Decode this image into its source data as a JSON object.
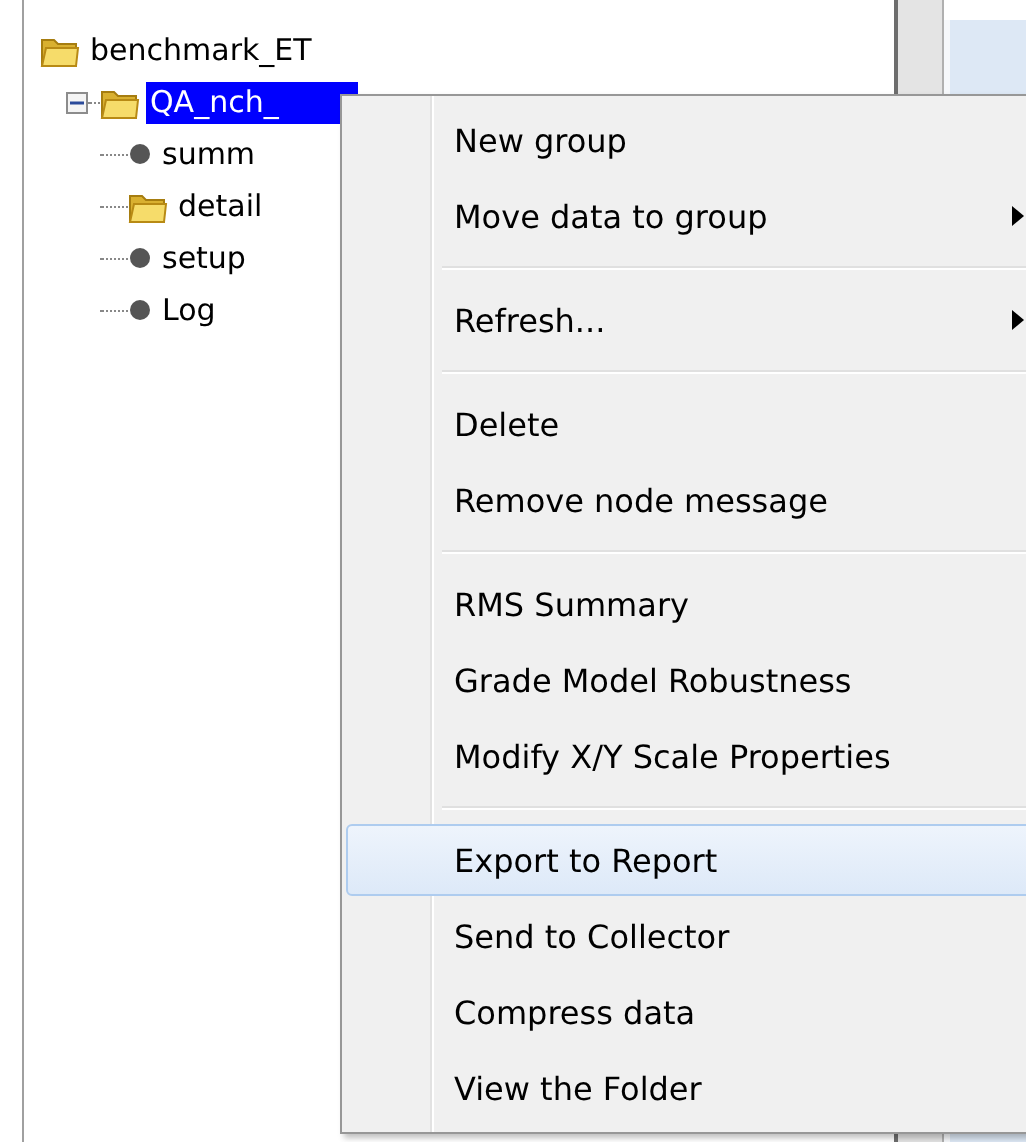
{
  "tree": [
    {
      "label": "benchmark_ET",
      "kind": "folder",
      "selected": false,
      "children": [
        {
          "label": "QA_nch_",
          "kind": "folder",
          "selected": true,
          "expanded": true,
          "children": [
            {
              "label": "summ",
              "kind": "leaf",
              "selected": false
            },
            {
              "label": "detail",
              "kind": "folder",
              "selected": false
            },
            {
              "label": "setup",
              "kind": "leaf",
              "selected": false
            },
            {
              "label": "Log",
              "kind": "leaf",
              "selected": false
            }
          ]
        }
      ]
    }
  ],
  "context_menu": [
    {
      "kind": "item",
      "label": "New group",
      "submenu": false,
      "selected": false
    },
    {
      "kind": "item",
      "label": "Move data to group",
      "submenu": true,
      "selected": false
    },
    {
      "kind": "separator"
    },
    {
      "kind": "item",
      "label": "Refresh...",
      "submenu": true,
      "selected": false
    },
    {
      "kind": "separator"
    },
    {
      "kind": "item",
      "label": "Delete",
      "submenu": false,
      "selected": false
    },
    {
      "kind": "item",
      "label": "Remove node message",
      "submenu": false,
      "selected": false
    },
    {
      "kind": "separator"
    },
    {
      "kind": "item",
      "label": "RMS Summary",
      "submenu": false,
      "selected": false
    },
    {
      "kind": "item",
      "label": "Grade Model Robustness",
      "submenu": false,
      "selected": false
    },
    {
      "kind": "item",
      "label": "Modify X/Y Scale Properties",
      "submenu": false,
      "selected": false
    },
    {
      "kind": "separator"
    },
    {
      "kind": "item",
      "label": "Export to Report",
      "submenu": false,
      "selected": true
    },
    {
      "kind": "item",
      "label": "Send to Collector",
      "submenu": false,
      "selected": false
    },
    {
      "kind": "item",
      "label": "Compress data",
      "submenu": false,
      "selected": false
    },
    {
      "kind": "item",
      "label": "View the Folder",
      "submenu": false,
      "selected": false
    }
  ]
}
